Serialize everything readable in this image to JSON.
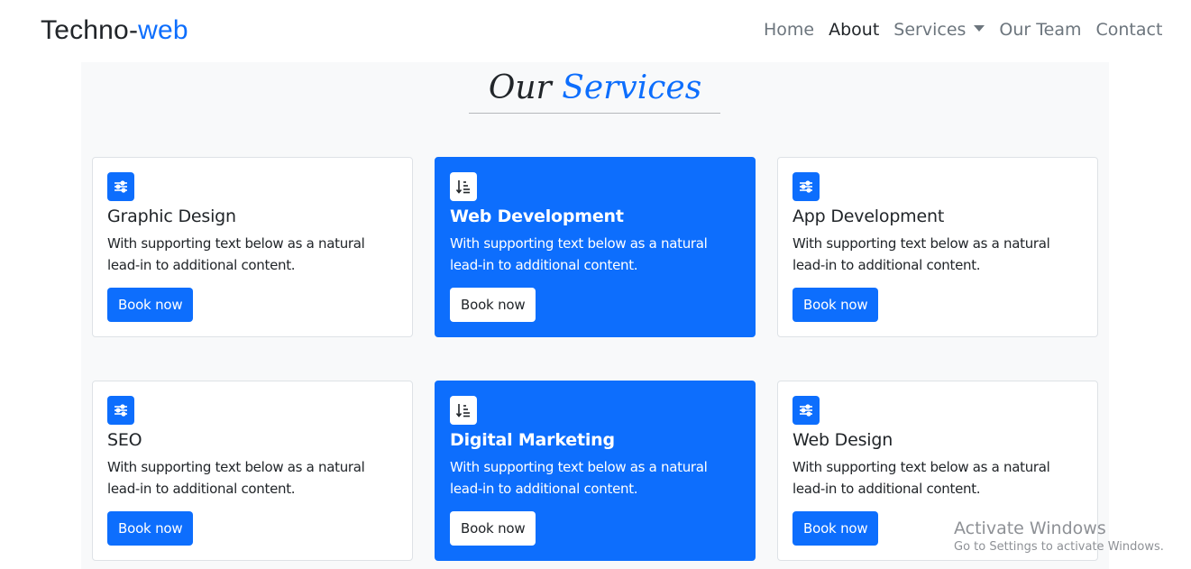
{
  "navbar": {
    "brand_prefix": "Techno-",
    "brand_accent": "web",
    "links": [
      {
        "label": "Home"
      },
      {
        "label": "About"
      },
      {
        "label": "Services"
      },
      {
        "label": "Our Team"
      },
      {
        "label": "Contact"
      }
    ]
  },
  "section": {
    "title_prefix": "Our",
    "title_accent": "Services"
  },
  "cards": [
    {
      "title": "Graphic Design",
      "text": "With supporting text below as a natural lead-in to additional content.",
      "button": "Book now",
      "icon": "sliders-icon"
    },
    {
      "title": "Web Development",
      "text": "With supporting text below as a natural lead-in to additional content.",
      "button": "Book now",
      "icon": "sort-down-icon"
    },
    {
      "title": "App Development",
      "text": "With supporting text below as a natural lead-in to additional content.",
      "button": "Book now",
      "icon": "sliders-icon"
    },
    {
      "title": "SEO",
      "text": "With supporting text below as a natural lead-in to additional content.",
      "button": "Book now",
      "icon": "sliders-icon"
    },
    {
      "title": "Digital Marketing",
      "text": "With supporting text below as a natural lead-in to additional content.",
      "button": "Book now",
      "icon": "sort-down-icon"
    },
    {
      "title": "Web Design",
      "text": "With supporting text below as a natural lead-in to additional content.",
      "button": "Book now",
      "icon": "sliders-icon"
    }
  ],
  "watermark": {
    "title": "Activate Windows",
    "subtitle": "Go to Settings to activate Windows."
  },
  "colors": {
    "accent": "#0d6efd",
    "text": "#212529",
    "muted": "#6c757d",
    "section_bg": "#f8f9fa"
  }
}
